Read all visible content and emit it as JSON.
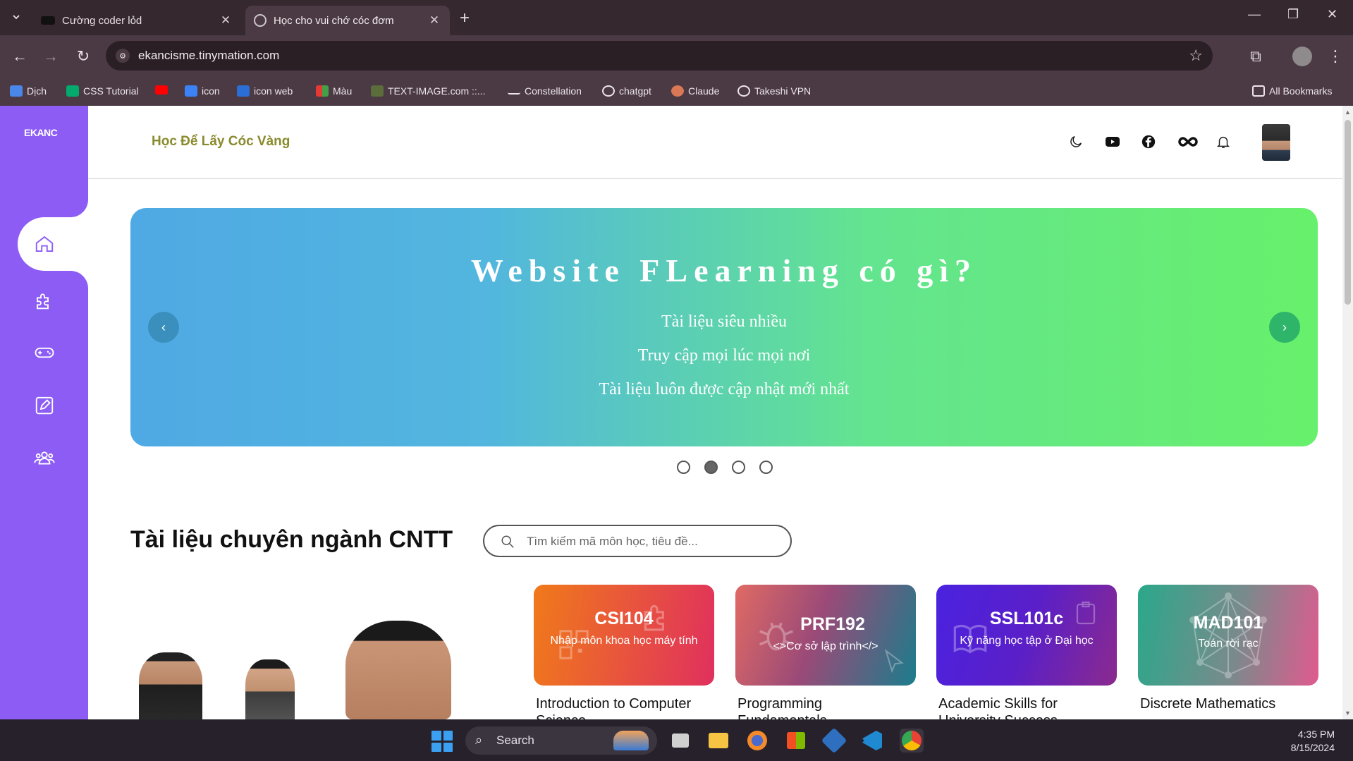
{
  "browser": {
    "tabs": [
      {
        "title": "Cường coder lỏd",
        "active": false
      },
      {
        "title": "Học cho vui chớ cóc đơm",
        "active": true
      }
    ],
    "url": "ekancisme.tinymation.com",
    "bookmarks": [
      {
        "label": "Dịch",
        "icon": "translate-icon"
      },
      {
        "label": "CSS Tutorial",
        "icon": "w3-icon"
      },
      {
        "label": "",
        "icon": "youtube-icon"
      },
      {
        "label": "icon",
        "icon": "folder-icon"
      },
      {
        "label": "icon web",
        "icon": "fa-icon"
      },
      {
        "label": "Màu",
        "icon": "color-grid-icon"
      },
      {
        "label": "TEXT-IMAGE.com ::...",
        "icon": "text-image-icon"
      },
      {
        "label": "Constellation",
        "icon": "underscore-icon"
      },
      {
        "label": "chatgpt",
        "icon": "openai-icon"
      },
      {
        "label": "Claude",
        "icon": "claude-icon"
      },
      {
        "label": "Takeshi VPN",
        "icon": "globe-icon"
      }
    ],
    "all_bookmarks": "All Bookmarks"
  },
  "sidebar": {
    "logo": "EKANC",
    "items": [
      {
        "name": "home",
        "icon": "home-icon",
        "active": true
      },
      {
        "name": "puzzle",
        "icon": "puzzle-icon",
        "active": false
      },
      {
        "name": "game",
        "icon": "gamepad-icon",
        "active": false
      },
      {
        "name": "edit",
        "icon": "edit-icon",
        "active": false
      },
      {
        "name": "community",
        "icon": "users-icon",
        "active": false
      }
    ]
  },
  "header": {
    "brand": "Học Để Lấy Cóc Vàng",
    "icons": [
      "moon-icon",
      "youtube-icon",
      "facebook-icon",
      "infinity-icon",
      "bell-icon"
    ]
  },
  "banner": {
    "title": "Website FLearning có gì?",
    "lines": [
      "Tài liệu siêu nhiều",
      "Truy cập mọi lúc mọi nơi",
      "Tài liệu luôn được cập nhật mới nhất"
    ],
    "slide_count": 4,
    "active_slide": 2
  },
  "section": {
    "title": "Tài liệu chuyên ngành CNTT",
    "search_placeholder": "Tìm kiếm mã môn học, tiêu đề..."
  },
  "courses": [
    {
      "code": "CSI104",
      "subtitle": "Nhập môn khoa học máy tính",
      "name": "Introduction to Computer Science",
      "colors": [
        "#f07a1a",
        "#e0305e"
      ]
    },
    {
      "code": "PRF192",
      "subtitle": "<>Cơ sở lập trình</>",
      "name": "Programming Fundamentals",
      "colors": [
        "#d85a5a",
        "#1a7d8c"
      ]
    },
    {
      "code": "SSL101c",
      "subtitle": "Kỹ năng học tập ở Đại học",
      "name": "Academic Skills for University Success",
      "colors": [
        "#4a22e0",
        "#8b2a8e"
      ]
    },
    {
      "code": "MAD101",
      "subtitle": "Toán rời rạc",
      "name": "Discrete Mathematics",
      "colors": [
        "#2aa88a",
        "#e05a8e"
      ]
    }
  ],
  "taskbar": {
    "search_label": "Search",
    "time": "4:35 PM",
    "date": "8/15/2024"
  }
}
